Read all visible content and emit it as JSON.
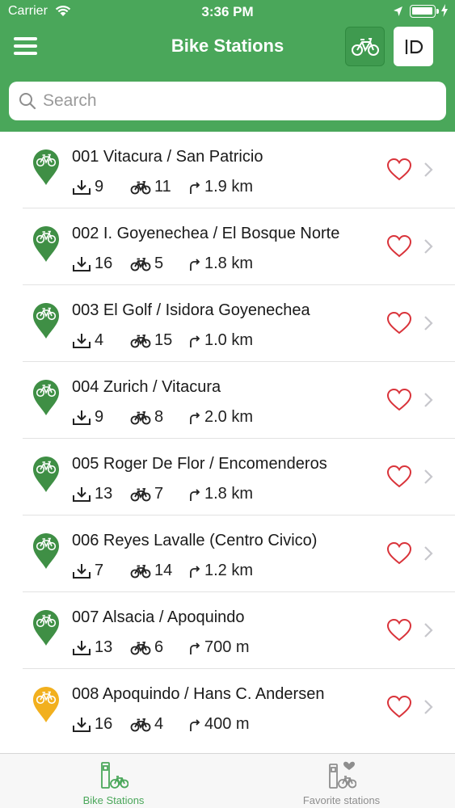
{
  "status_bar": {
    "carrier": "Carrier",
    "time": "3:36 PM"
  },
  "nav": {
    "title": "Bike Stations",
    "menu_icon": "hamburger-icon",
    "bike_toggle_icon": "bicycle-icon",
    "dock_toggle_icon": "dock-icon"
  },
  "search": {
    "placeholder": "Search",
    "value": ""
  },
  "stations": [
    {
      "name": "001 Vitacura / San Patricio",
      "docks": "9",
      "bikes": "11",
      "distance": "1.9 km",
      "pin_color": "#3f8f45",
      "favorite": false
    },
    {
      "name": "002 I. Goyenechea / El Bosque Norte",
      "docks": "16",
      "bikes": "5",
      "distance": "1.8 km",
      "pin_color": "#3f8f45",
      "favorite": false
    },
    {
      "name": "003 El Golf / Isidora Goyenechea",
      "docks": "4",
      "bikes": "15",
      "distance": "1.0 km",
      "pin_color": "#3f8f45",
      "favorite": false
    },
    {
      "name": "004 Zurich / Vitacura",
      "docks": "9",
      "bikes": "8",
      "distance": "2.0 km",
      "pin_color": "#3f8f45",
      "favorite": false
    },
    {
      "name": "005 Roger De Flor / Encomenderos",
      "docks": "13",
      "bikes": "7",
      "distance": "1.8 km",
      "pin_color": "#3f8f45",
      "favorite": false
    },
    {
      "name": "006 Reyes Lavalle (Centro Civico)",
      "docks": "7",
      "bikes": "14",
      "distance": "1.2 km",
      "pin_color": "#3f8f45",
      "favorite": false
    },
    {
      "name": "007 Alsacia / Apoquindo",
      "docks": "13",
      "bikes": "6",
      "distance": "700 m",
      "pin_color": "#3f8f45",
      "favorite": false
    },
    {
      "name": "008 Apoquindo / Hans C. Andersen",
      "docks": "16",
      "bikes": "4",
      "distance": "400 m",
      "pin_color": "#f2b01e",
      "favorite": false
    }
  ],
  "tabs": [
    {
      "label": "Bike Stations",
      "active": true
    },
    {
      "label": "Favorite stations",
      "active": false
    }
  ],
  "colors": {
    "brand_green": "#4aa75a",
    "heart_red": "#d9333a",
    "pin_green": "#3f8f45",
    "pin_yellow": "#f2b01e"
  }
}
